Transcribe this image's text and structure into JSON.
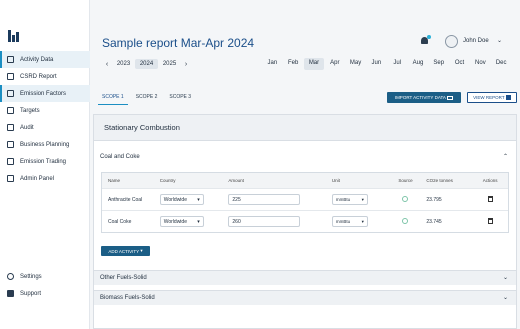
{
  "sidebar": {
    "items": [
      {
        "label": "Activity Data",
        "icon": "list-icon",
        "active": true
      },
      {
        "label": "CSRD Report",
        "icon": "document-icon",
        "active": false
      },
      {
        "label": "Emission Factors",
        "icon": "factors-icon",
        "active": true
      },
      {
        "label": "Targets",
        "icon": "target-icon",
        "active": false
      },
      {
        "label": "Audit",
        "icon": "audit-icon",
        "active": false
      },
      {
        "label": "Business Planning",
        "icon": "briefcase-icon",
        "active": false
      },
      {
        "label": "Emission Trading",
        "icon": "trend-icon",
        "active": false
      },
      {
        "label": "Admin Panel",
        "icon": "admin-icon",
        "active": false
      }
    ],
    "bottom": [
      {
        "label": "Settings",
        "icon": "gear-icon"
      },
      {
        "label": "Support",
        "icon": "support-icon"
      }
    ]
  },
  "header": {
    "title": "Sample report Mar-Apr 2024",
    "years": [
      "2023",
      "2024",
      "2025"
    ],
    "selected_year": "2024",
    "months": [
      "Jan",
      "Feb",
      "Mar",
      "Apr",
      "May",
      "Jun",
      "Jul",
      "Aug",
      "Sep",
      "Oct",
      "Nov",
      "Dec"
    ],
    "selected_months": [
      "Mar"
    ],
    "user_name": "John Doe"
  },
  "scopes": {
    "tabs": [
      "SCOPE 1",
      "SCOPE 2",
      "SCOPE 3"
    ],
    "active": "SCOPE 1",
    "import_label": "IMPORT ACTIVITY DATA",
    "view_report_label": "VIEW REPORT"
  },
  "panel": {
    "title": "Stationary Combustion",
    "accordion_title": "Coal and Coke",
    "columns": [
      "Name",
      "Country",
      "Amount",
      "Unit",
      "Source",
      "CO2e tonnes",
      "Actions"
    ],
    "rows": [
      {
        "name": "Anthracite Coal",
        "country": "Worldwide",
        "amount": "225",
        "unit": "mmBtu",
        "co2e": "23.795"
      },
      {
        "name": "Coal Coke",
        "country": "Worldwide",
        "amount": "260",
        "unit": "mmBtu",
        "co2e": "23.745"
      }
    ],
    "add_activity_label": "ADD ACTIVITY",
    "sections": [
      "Other Fuels-Solid",
      "Biomass Fuels-Solid"
    ]
  },
  "colors": {
    "accent": "#1b5e86",
    "title": "#1b4f8a",
    "active_nav": "#e8f1f7"
  }
}
